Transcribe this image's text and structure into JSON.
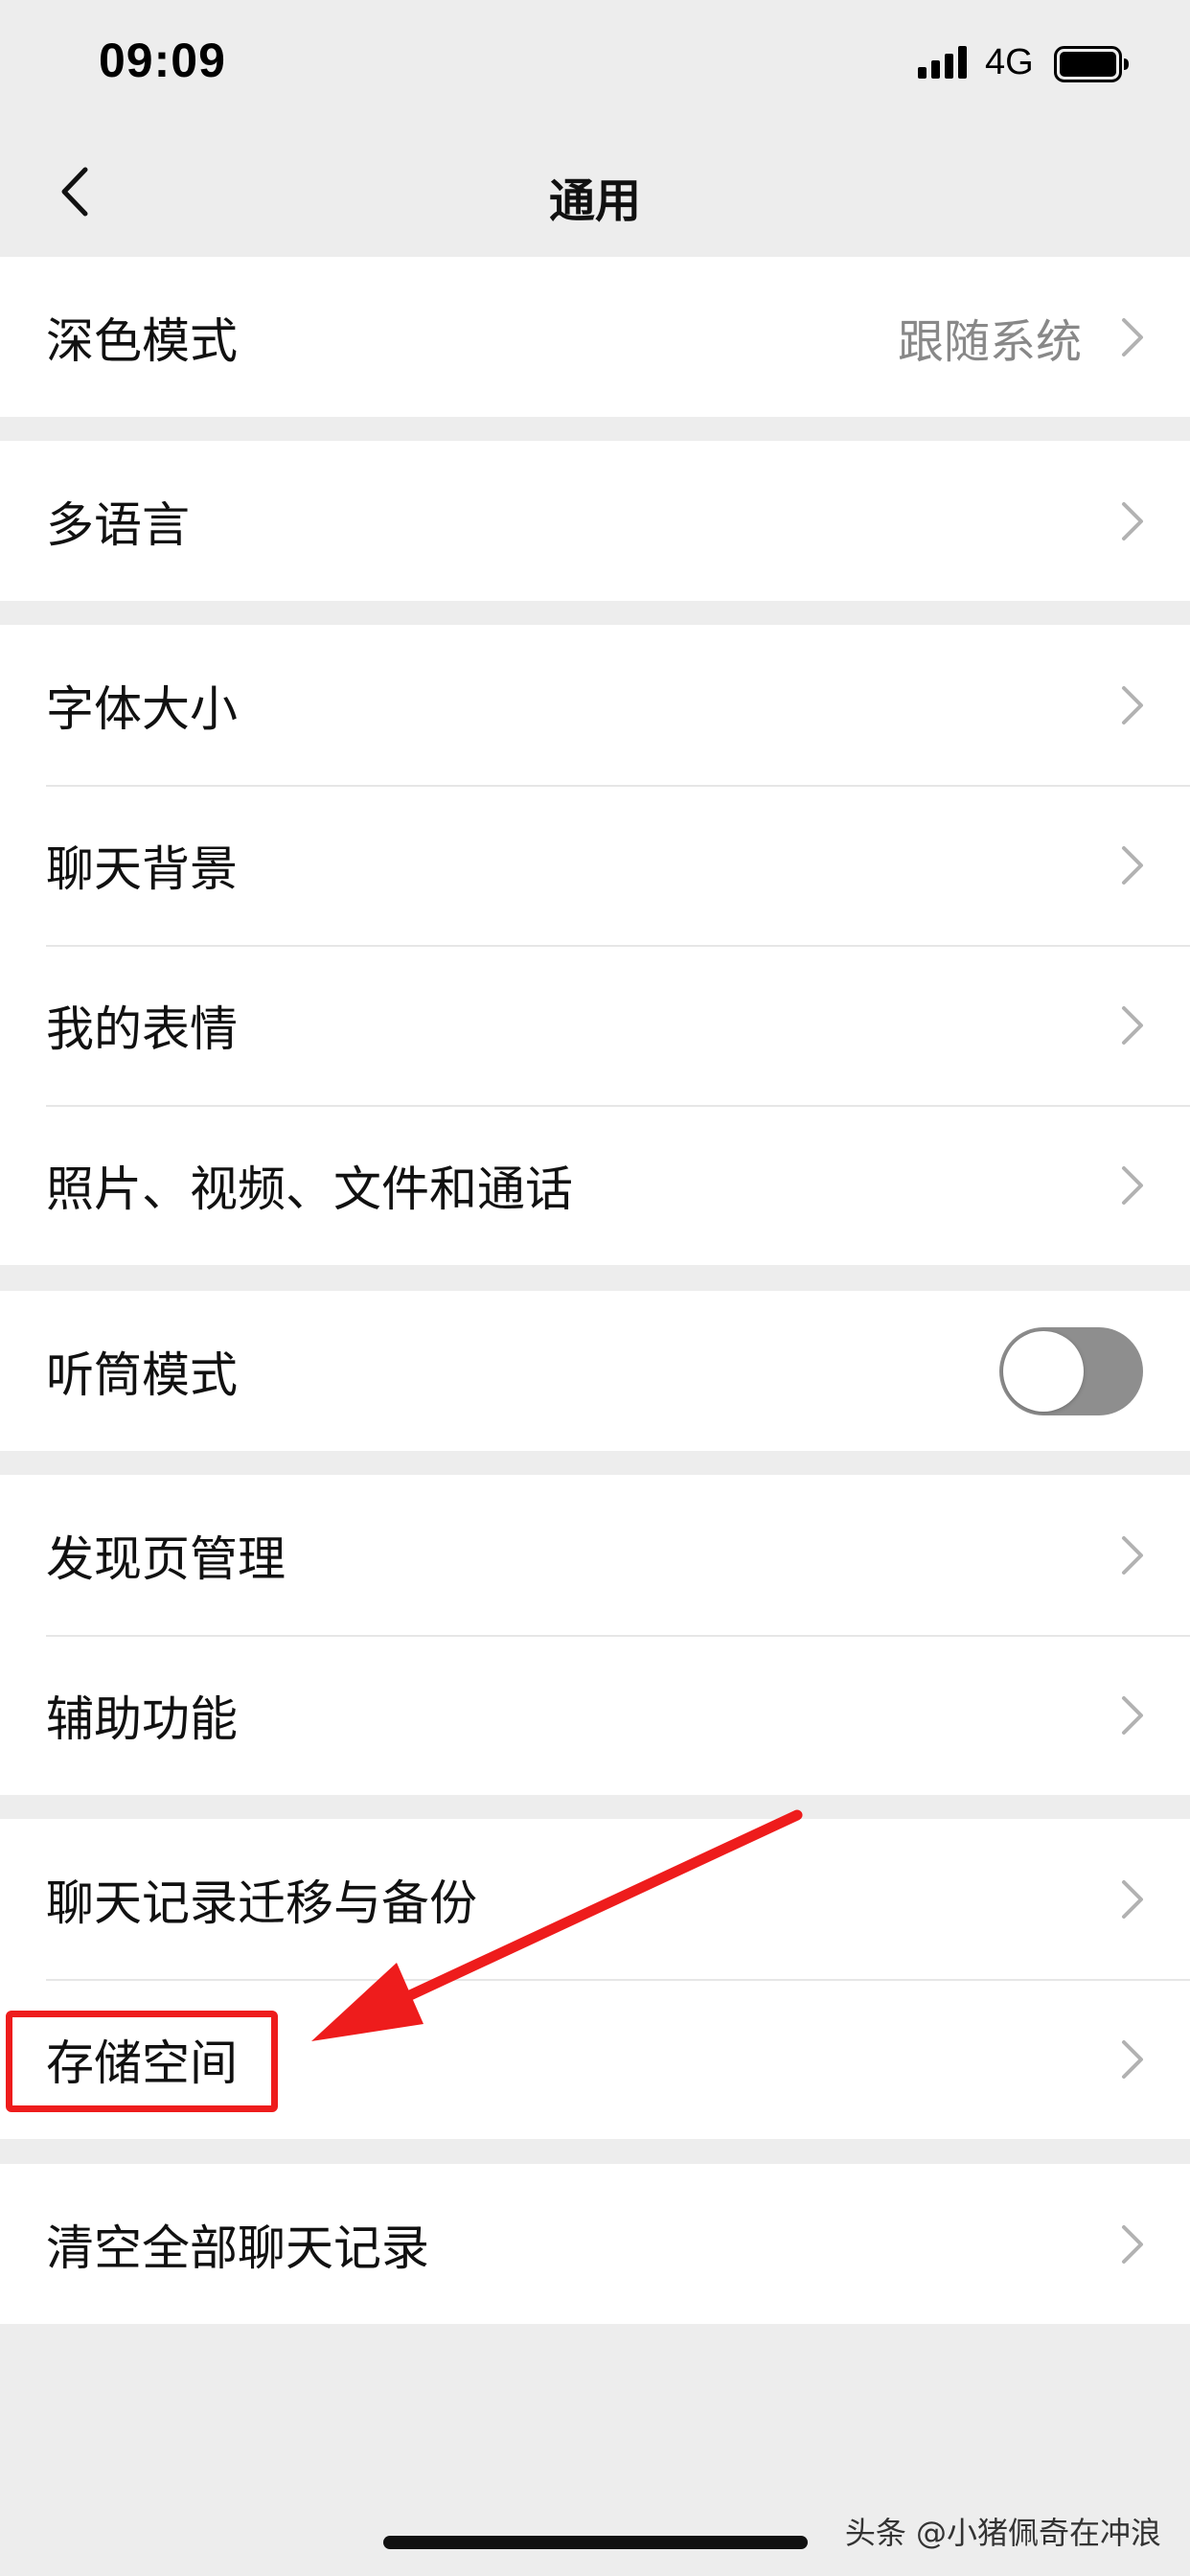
{
  "status_bar": {
    "time": "09:09",
    "network": "4G"
  },
  "nav": {
    "title": "通用",
    "back_icon": "chevron-left-icon"
  },
  "groups": [
    {
      "items": [
        {
          "label": "深色模式",
          "value": "跟随系统",
          "type": "link"
        }
      ]
    },
    {
      "items": [
        {
          "label": "多语言",
          "type": "link"
        }
      ]
    },
    {
      "items": [
        {
          "label": "字体大小",
          "type": "link"
        },
        {
          "label": "聊天背景",
          "type": "link"
        },
        {
          "label": "我的表情",
          "type": "link"
        },
        {
          "label": "照片、视频、文件和通话",
          "type": "link"
        }
      ]
    },
    {
      "items": [
        {
          "label": "听筒模式",
          "type": "toggle",
          "on": false
        }
      ]
    },
    {
      "items": [
        {
          "label": "发现页管理",
          "type": "link"
        },
        {
          "label": "辅助功能",
          "type": "link"
        }
      ]
    },
    {
      "items": [
        {
          "label": "聊天记录迁移与备份",
          "type": "link"
        },
        {
          "label": "存储空间",
          "type": "link",
          "highlighted": true
        }
      ]
    },
    {
      "items": [
        {
          "label": "清空全部聊天记录",
          "type": "link"
        }
      ]
    }
  ],
  "annotation": {
    "highlight_color": "#ee1c1c"
  },
  "watermark": "头条 @小猪佩奇在冲浪",
  "colors": {
    "background": "#ededed",
    "row_background": "#ffffff",
    "toggle_off": "#8e8e8e"
  }
}
